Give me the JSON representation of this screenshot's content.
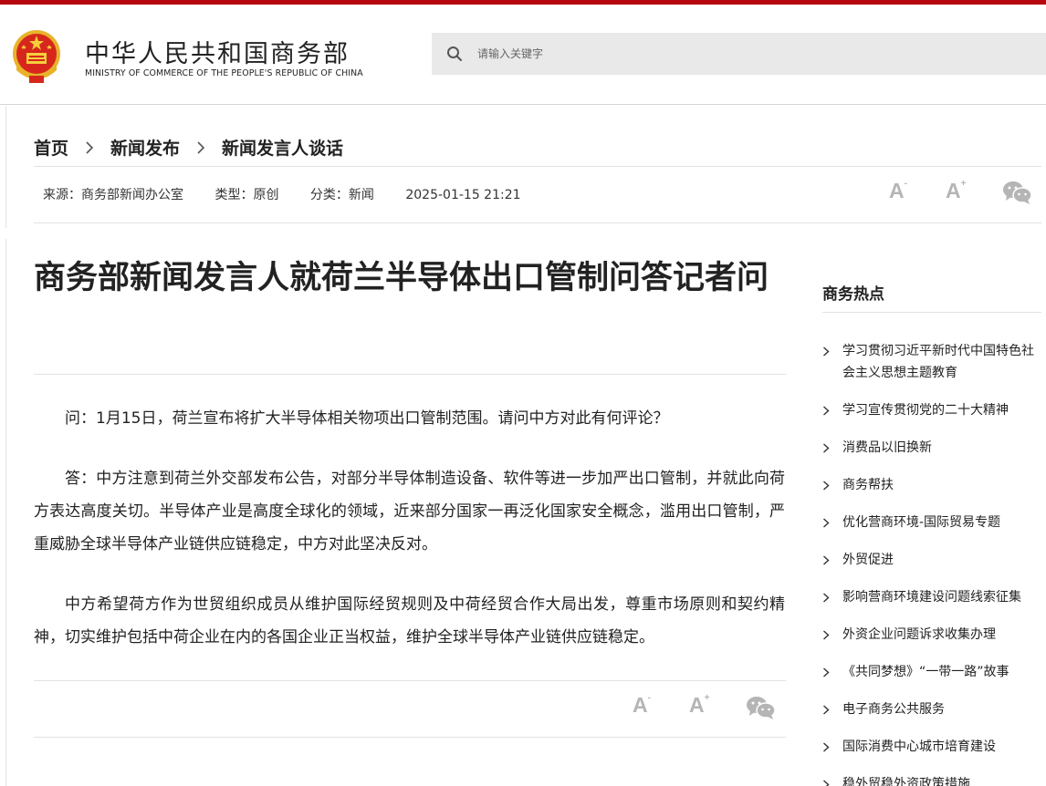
{
  "site": {
    "title": "中华人民共和国商务部",
    "subtitle_en": "MINISTRY OF COMMERCE OF THE PEOPLE'S REPUBLIC OF CHINA"
  },
  "search": {
    "placeholder": "请输入关键字",
    "icon": "search-icon"
  },
  "breadcrumb": [
    {
      "label": "首页"
    },
    {
      "label": "新闻发布"
    },
    {
      "label": "新闻发言人谈话"
    }
  ],
  "meta": {
    "source": "来源：商务部新闻办公室",
    "type": "类型：原创",
    "category": "分类：新闻",
    "datetime": "2025-01-15 21:21"
  },
  "tools": {
    "font_smaller": "A",
    "font_smaller_mark": "-",
    "font_larger": "A",
    "font_larger_mark": "+",
    "share_icon": "wechat-icon"
  },
  "article": {
    "title": "商务部新闻发言人就荷兰半导体出口管制问答记者问",
    "paragraphs": [
      "问：1月15日，荷兰宣布将扩大半导体相关物项出口管制范围。请问中方对此有何评论？",
      "答：中方注意到荷兰外交部发布公告，对部分半导体制造设备、软件等进一步加严出口管制，并就此向荷方表达高度关切。半导体产业是高度全球化的领域，近来部分国家一再泛化国家安全概念，滥用出口管制，严重威胁全球半导体产业链供应链稳定，中方对此坚决反对。",
      "中方希望荷方作为世贸组织成员从维护国际经贸规则及中荷经贸合作大局出发，尊重市场原则和契约精神，切实维护包括中荷企业在内的各国企业正当权益，维护全球半导体产业链供应链稳定。"
    ]
  },
  "sidebar": {
    "heading": "商务热点",
    "items": [
      "学习贯彻习近平新时代中国特色社会主义思想主题教育",
      "学习宣传贯彻党的二十大精神",
      "消费品以旧换新",
      "商务帮扶",
      "优化营商环境-国际贸易专题",
      "外贸促进",
      "影响营商环境建设问题线索征集",
      "外资企业问题诉求收集办理",
      "《共同梦想》“一带一路”故事",
      "电子商务公共服务",
      "国际消费中心城市培育建设",
      "稳外贸稳外资政策措施"
    ]
  },
  "colors": {
    "brand_red": "#b6070e",
    "search_bg": "#e9e9e9",
    "tool_gray": "#b5b5b5"
  }
}
